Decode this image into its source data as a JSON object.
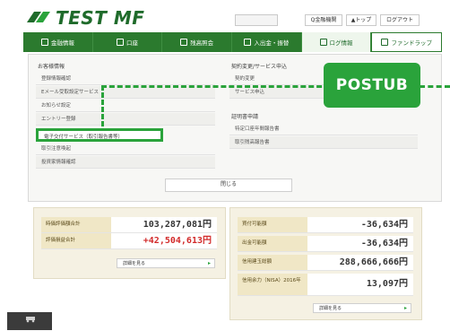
{
  "header": {
    "logo_text": "TEST MF",
    "search_placeholder": "",
    "buttons": [
      "Q金融機関",
      "▲トップ",
      "ログアウト"
    ]
  },
  "nav": {
    "items": [
      {
        "label": "金融情報"
      },
      {
        "label": "口座"
      },
      {
        "label": "残高照会"
      },
      {
        "label": "入出金・振替"
      },
      {
        "label": "ログ情報",
        "active": true
      },
      {
        "label": "ファンドラップ"
      }
    ]
  },
  "dropdown": {
    "left_heading": "お客様情報",
    "left_items": [
      "登録情報確認",
      "Eメール受取設定サービス",
      "お知らせ設定",
      "エントリー登録",
      "電子交付サービス（取引報告書等）",
      "取引注意喚起",
      "投資家情報確認"
    ],
    "right_heading": "契約変更/サービス申込",
    "right_items": [
      "契約変更",
      "サービス申込"
    ],
    "right_heading2": "証明書申請",
    "right_items2": [
      "特定口座年間報告書",
      "取引残高報告書"
    ],
    "close_label": "閉じる"
  },
  "badge": {
    "label": "POSTUB"
  },
  "summary_left": {
    "rows": [
      {
        "label": "時価評価額合計",
        "value": "103,287,081円"
      },
      {
        "label": "評価損益合計",
        "value": "+42,504,613円",
        "color": "#d22a2a"
      }
    ],
    "detail_button": "詳細を見る"
  },
  "summary_right": {
    "rows": [
      {
        "label": "買付可能額",
        "value": "-36,634円"
      },
      {
        "label": "出金可能額",
        "value": "-36,634円"
      },
      {
        "label": "信用建玉総額",
        "value": "288,666,666円"
      },
      {
        "label": "信用余力（NISA）2016年",
        "value": "13,097円"
      }
    ],
    "detail_button": "詳細を見る"
  },
  "footer": {
    "label": ""
  }
}
